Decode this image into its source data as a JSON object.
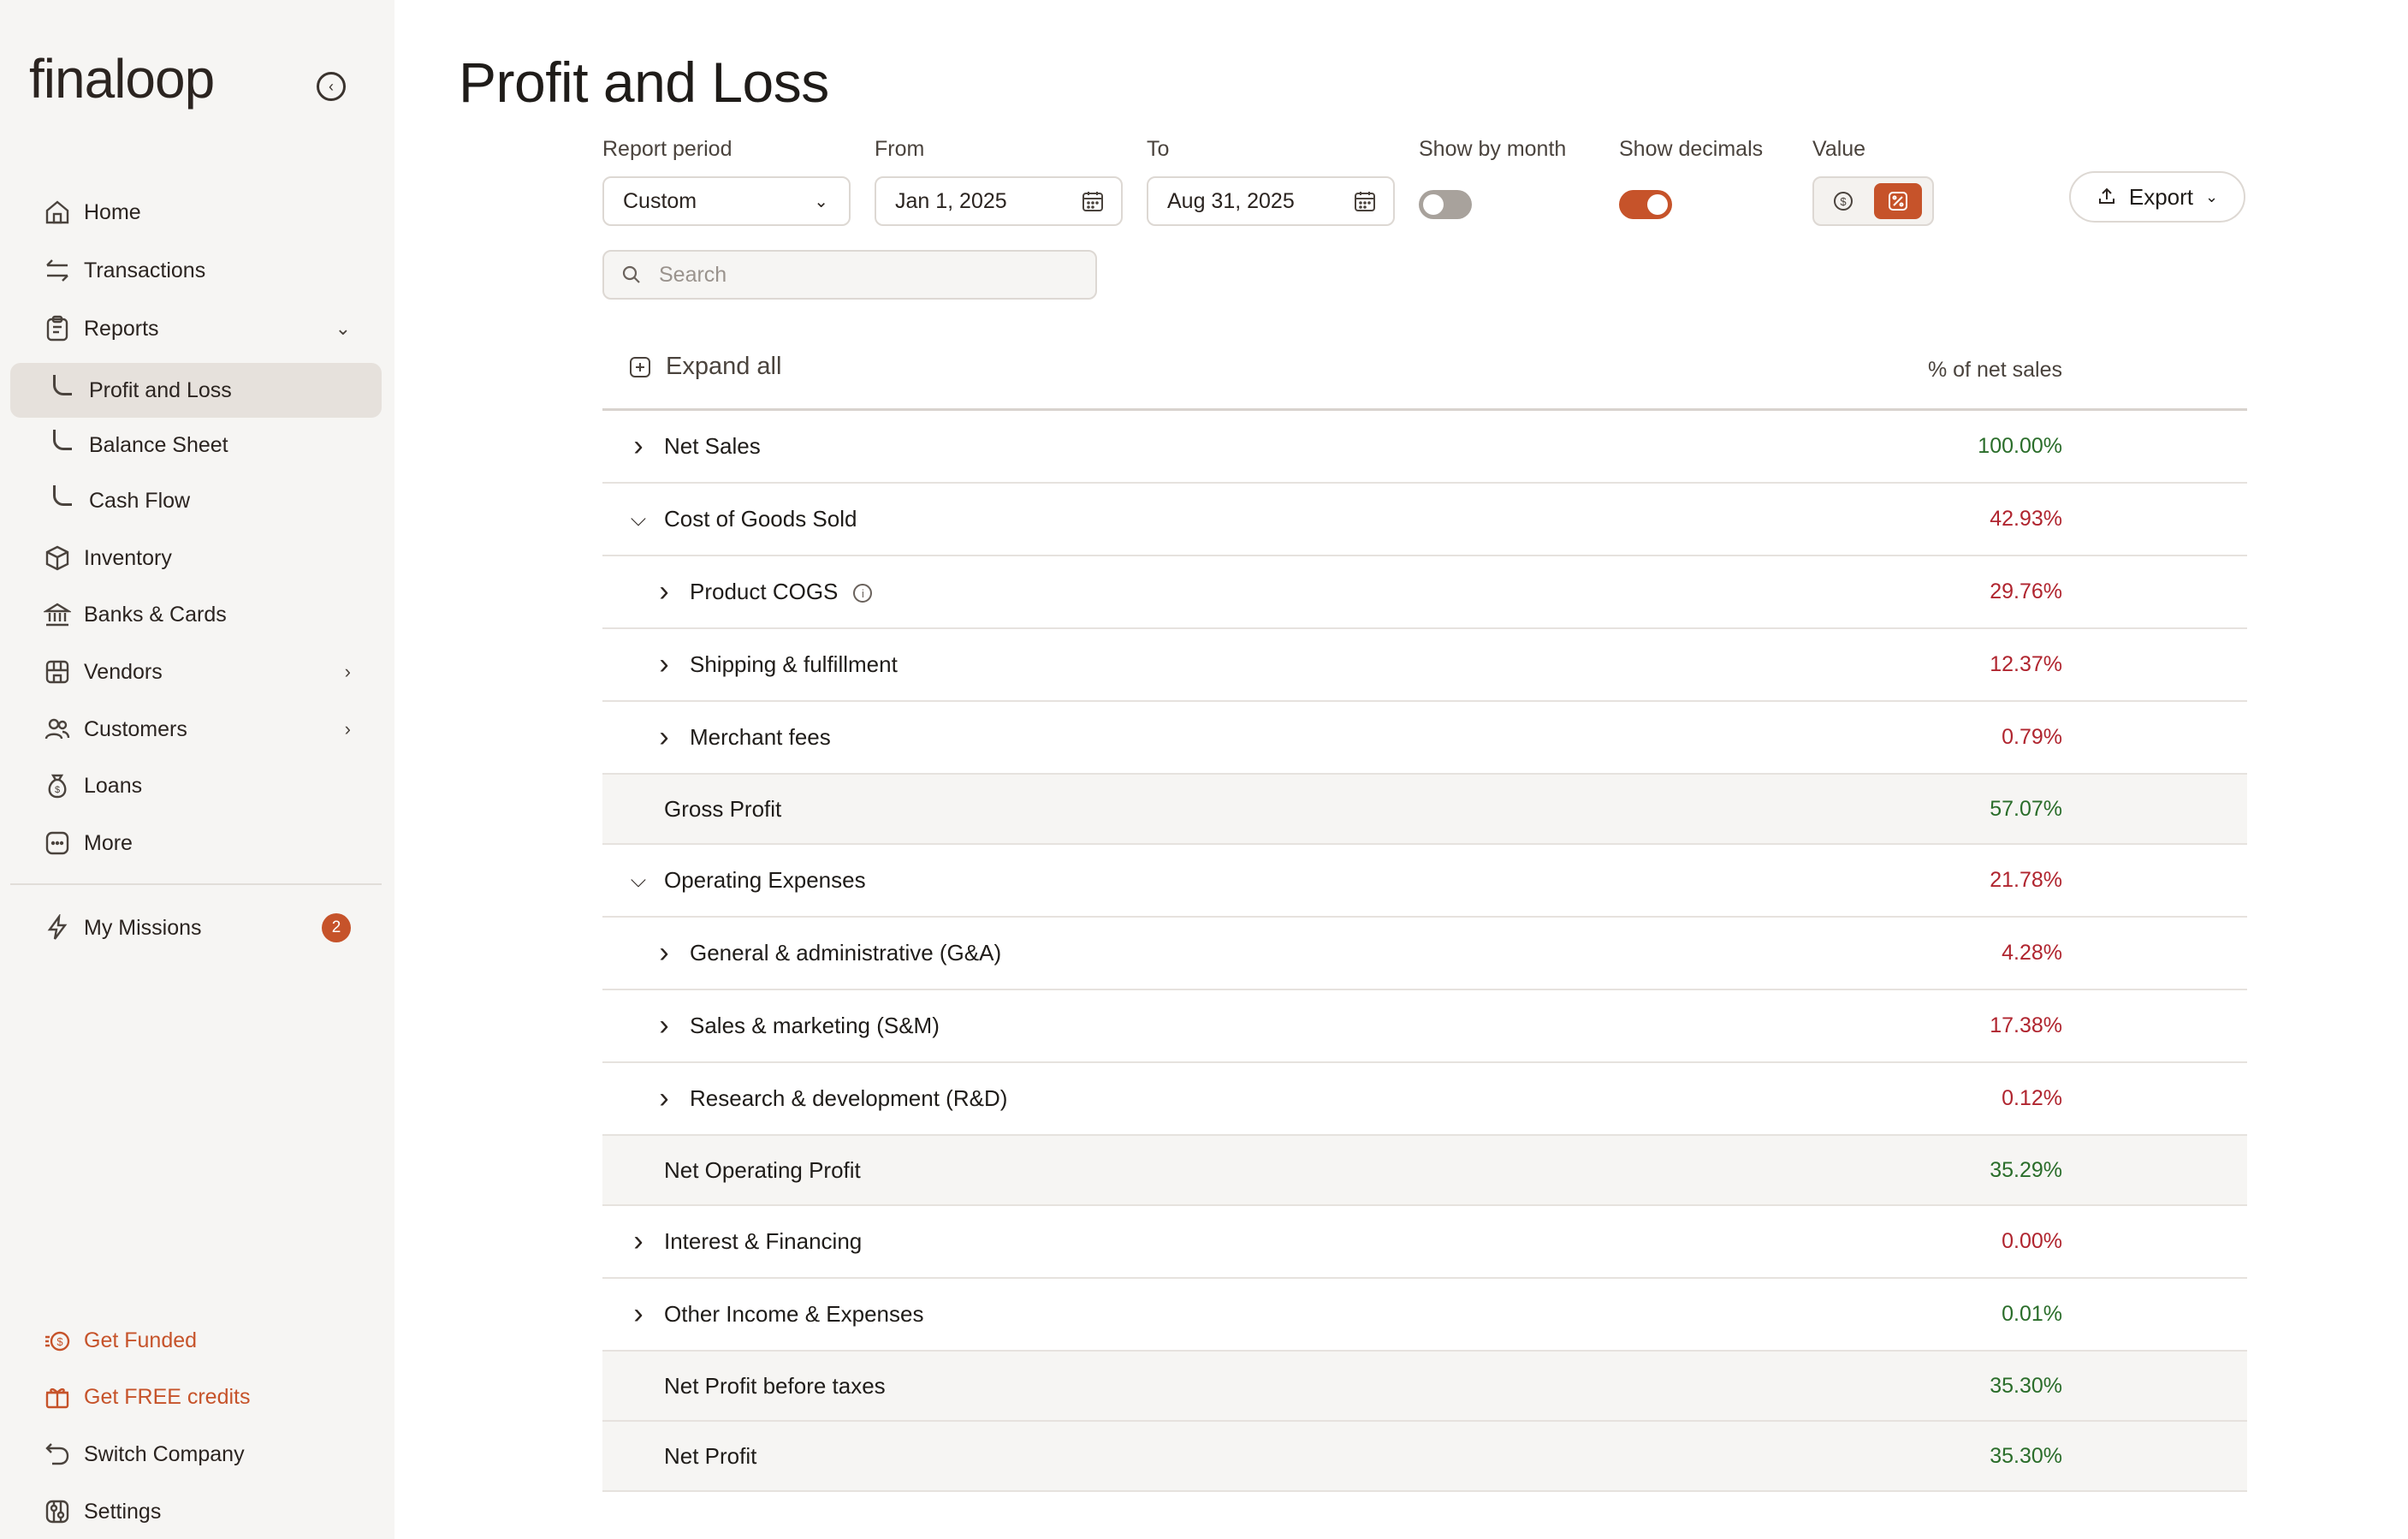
{
  "app": {
    "logo_text": "finaloop"
  },
  "sidebar": {
    "items": [
      {
        "label": "Home",
        "icon": "home-icon"
      },
      {
        "label": "Transactions",
        "icon": "arrows-icon"
      },
      {
        "label": "Reports",
        "icon": "clipboard-icon"
      },
      {
        "label": "Profit and Loss"
      },
      {
        "label": "Balance Sheet"
      },
      {
        "label": "Cash Flow"
      },
      {
        "label": "Inventory",
        "icon": "box-icon"
      },
      {
        "label": "Banks & Cards",
        "icon": "bank-icon"
      },
      {
        "label": "Vendors",
        "icon": "store-icon"
      },
      {
        "label": "Customers",
        "icon": "users-icon"
      },
      {
        "label": "Loans",
        "icon": "money-bag-icon"
      },
      {
        "label": "More",
        "icon": "more-icon"
      }
    ],
    "missions": {
      "label": "My Missions",
      "badge": "2"
    },
    "bottom": [
      {
        "label": "Get Funded",
        "icon": "funding-icon"
      },
      {
        "label": "Get FREE credits",
        "icon": "gift-icon"
      },
      {
        "label": "Switch Company",
        "icon": "switch-icon"
      },
      {
        "label": "Settings",
        "icon": "settings-icon"
      }
    ],
    "accent_color": "#c6532a"
  },
  "header": {
    "title": "Profit and Loss",
    "report_period_label": "Report period",
    "report_period_value": "Custom",
    "from_label": "From",
    "from_value": "Jan 1, 2025",
    "to_label": "To",
    "to_value": "Aug 31, 2025",
    "show_by_month_label": "Show by month",
    "show_by_month": false,
    "show_decimals_label": "Show decimals",
    "show_decimals": true,
    "value_label": "Value",
    "value_mode": "percent",
    "export_label": "Export",
    "search_placeholder": "Search"
  },
  "table": {
    "expand_all_label": "Expand all",
    "column_header": "% of net sales",
    "rows": [
      {
        "label": "Net Sales",
        "pct": "100.00%",
        "state": "collapsed",
        "level": 0,
        "tone": "green"
      },
      {
        "label": "Cost of Goods Sold",
        "pct": "42.93%",
        "state": "expanded",
        "level": 0,
        "tone": "red"
      },
      {
        "label": "Product COGS",
        "pct": "29.76%",
        "state": "collapsed",
        "level": 1,
        "tone": "red",
        "info": true
      },
      {
        "label": "Shipping & fulfillment",
        "pct": "12.37%",
        "state": "collapsed",
        "level": 1,
        "tone": "red"
      },
      {
        "label": "Merchant fees",
        "pct": "0.79%",
        "state": "collapsed",
        "level": 1,
        "tone": "red"
      },
      {
        "label": "Gross Profit",
        "pct": "57.07%",
        "state": "total",
        "level": 0,
        "tone": "green"
      },
      {
        "label": "Operating Expenses",
        "pct": "21.78%",
        "state": "expanded",
        "level": 0,
        "tone": "red"
      },
      {
        "label": "General & administrative (G&A)",
        "pct": "4.28%",
        "state": "collapsed",
        "level": 1,
        "tone": "red"
      },
      {
        "label": "Sales & marketing (S&M)",
        "pct": "17.38%",
        "state": "collapsed",
        "level": 1,
        "tone": "red"
      },
      {
        "label": "Research & development (R&D)",
        "pct": "0.12%",
        "state": "collapsed",
        "level": 1,
        "tone": "red"
      },
      {
        "label": "Net Operating Profit",
        "pct": "35.29%",
        "state": "total",
        "level": 0,
        "tone": "green"
      },
      {
        "label": "Interest & Financing",
        "pct": "0.00%",
        "state": "collapsed",
        "level": 0,
        "tone": "red"
      },
      {
        "label": "Other Income & Expenses",
        "pct": "0.01%",
        "state": "collapsed",
        "level": 0,
        "tone": "green"
      },
      {
        "label": "Net Profit before taxes",
        "pct": "35.30%",
        "state": "total",
        "level": 0,
        "tone": "green"
      },
      {
        "label": "Net Profit",
        "pct": "35.30%",
        "state": "total",
        "level": 0,
        "tone": "green"
      }
    ]
  }
}
